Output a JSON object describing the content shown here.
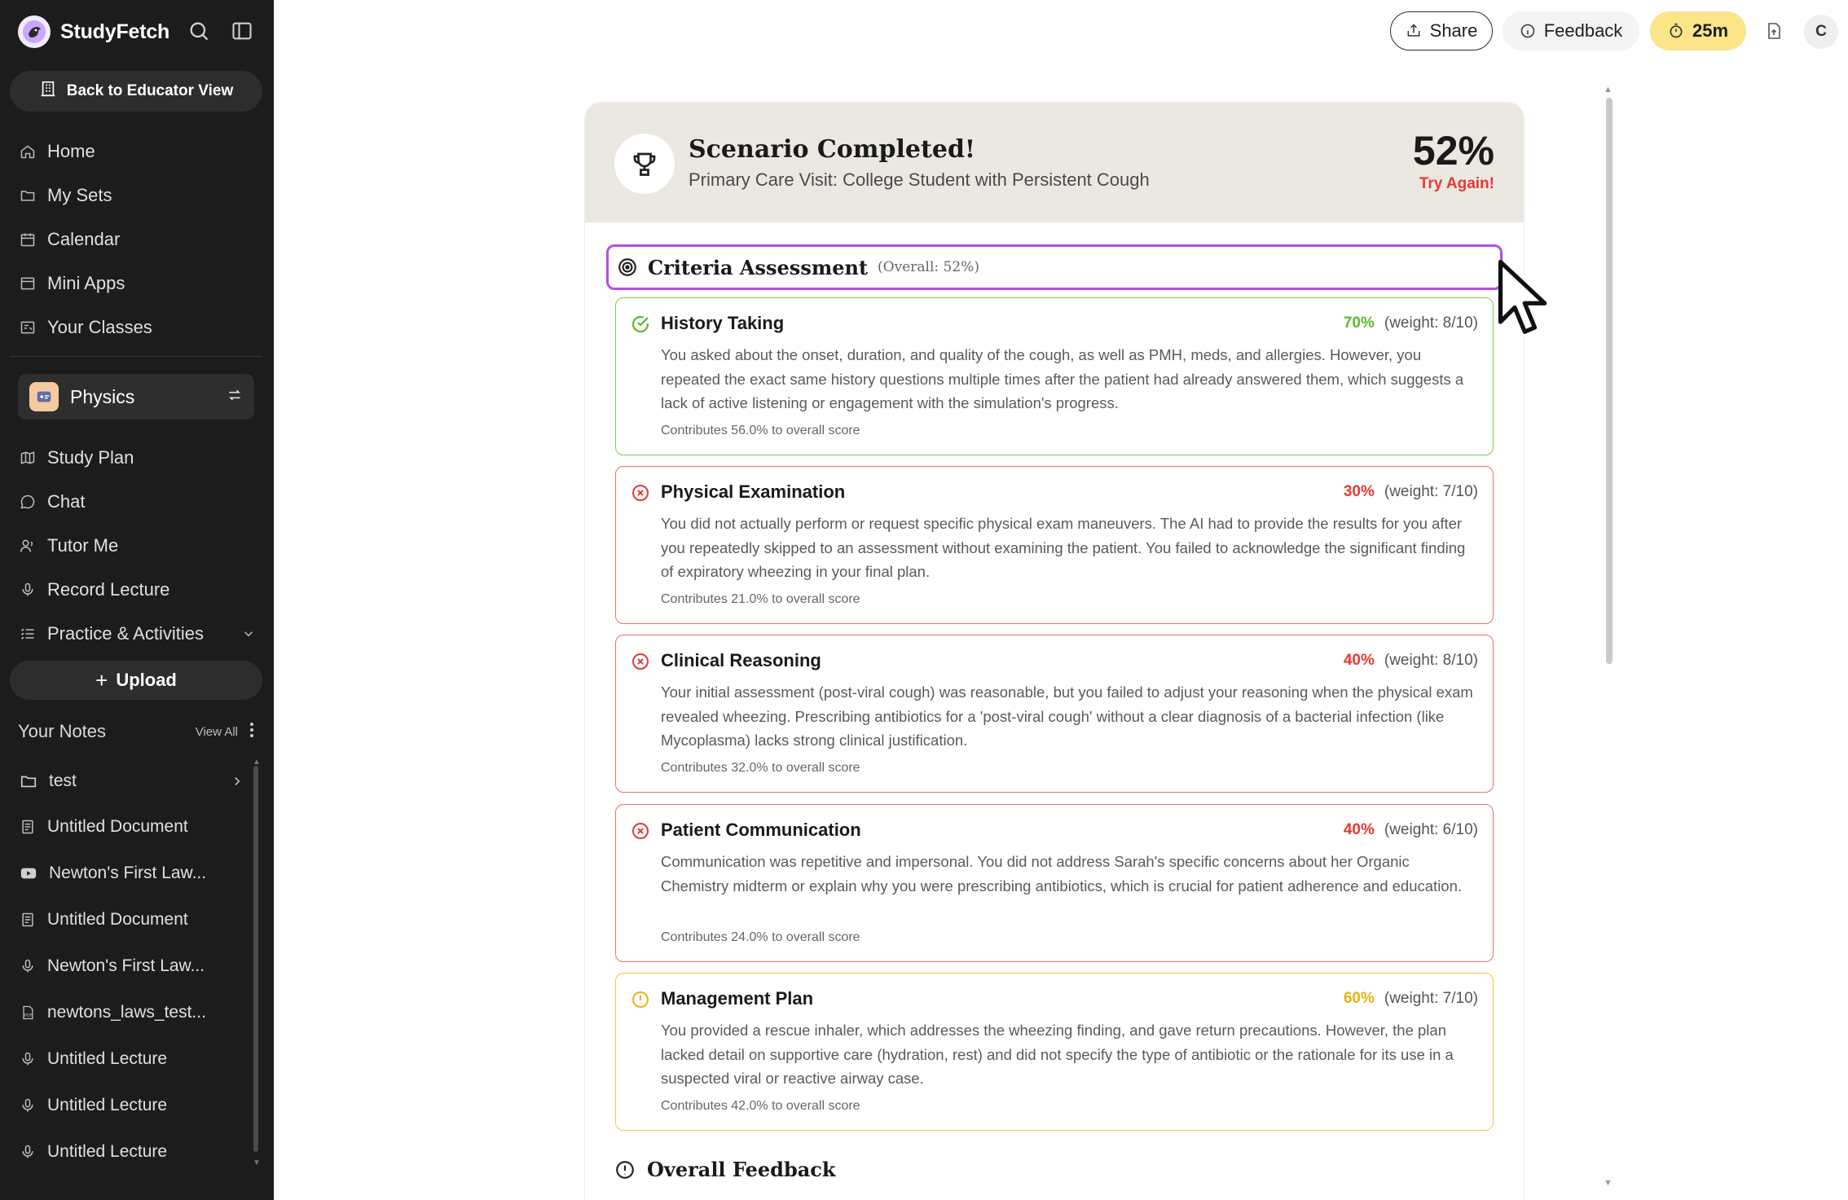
{
  "app": {
    "name": "StudyFetch"
  },
  "sidebar": {
    "educator_button": "Back to Educator View",
    "nav": [
      {
        "label": "Home",
        "icon": "home-icon"
      },
      {
        "label": "My Sets",
        "icon": "folder-icon"
      },
      {
        "label": "Calendar",
        "icon": "calendar-icon"
      },
      {
        "label": "Mini Apps",
        "icon": "app-window-icon"
      },
      {
        "label": "Your Classes",
        "icon": "classes-icon"
      }
    ],
    "class": {
      "name": "Physics"
    },
    "class_nav": [
      {
        "label": "Study Plan",
        "icon": "map-icon"
      },
      {
        "label": "Chat",
        "icon": "chat-icon"
      },
      {
        "label": "Tutor Me",
        "icon": "tutor-icon"
      },
      {
        "label": "Record Lecture",
        "icon": "microphone-icon"
      },
      {
        "label": "Practice & Activities",
        "icon": "list-icon"
      }
    ],
    "upload_label": "Upload",
    "notes": {
      "title": "Your Notes",
      "view_all": "View All",
      "items": [
        {
          "label": "test",
          "icon": "folder-icon"
        },
        {
          "label": "Untitled Document",
          "icon": "document-icon"
        },
        {
          "label": "Newton's First Law...",
          "icon": "youtube-icon"
        },
        {
          "label": "Untitled Document",
          "icon": "document-icon"
        },
        {
          "label": "Newton's First Law...",
          "icon": "microphone-icon"
        },
        {
          "label": "newtons_laws_test...",
          "icon": "pdf-icon"
        },
        {
          "label": "Untitled Lecture",
          "icon": "microphone-icon"
        },
        {
          "label": "Untitled Lecture",
          "icon": "microphone-icon"
        },
        {
          "label": "Untitled Lecture",
          "icon": "microphone-icon"
        }
      ]
    }
  },
  "topbar": {
    "share_label": "Share",
    "feedback_label": "Feedback",
    "timer_label": "25m",
    "avatar_initial": "C"
  },
  "scenario": {
    "title": "Scenario Completed!",
    "subtitle": "Primary Care Visit: College Student with Persistent Cough",
    "score": "52%",
    "status": "Try Again!"
  },
  "criteria": {
    "title": "Criteria Assessment",
    "overall": "(Overall: 52%)",
    "items": [
      {
        "name": "History Taking",
        "percent": "70%",
        "weight": "(weight: 8/10)",
        "status": "pass",
        "feedback": "You asked about the onset, duration, and quality of the cough, as well as PMH, meds, and allergies. However, you repeated the exact same history questions multiple times after the patient had already answered them, which suggests a lack of active listening or engagement with the simulation's progress.",
        "contribution": "Contributes 56.0% to overall score"
      },
      {
        "name": "Physical Examination",
        "percent": "30%",
        "weight": "(weight: 7/10)",
        "status": "fail",
        "feedback": "You did not actually perform or request specific physical exam maneuvers. The AI had to provide the results for you after you repeatedly skipped to an assessment without examining the patient. You failed to acknowledge the significant finding of expiratory wheezing in your final plan.",
        "contribution": "Contributes 21.0% to overall score"
      },
      {
        "name": "Clinical Reasoning",
        "percent": "40%",
        "weight": "(weight: 8/10)",
        "status": "fail",
        "feedback": "Your initial assessment (post-viral cough) was reasonable, but you failed to adjust your reasoning when the physical exam revealed wheezing. Prescribing antibiotics for a 'post-viral cough' without a clear diagnosis of a bacterial infection (like Mycoplasma) lacks strong clinical justification.",
        "contribution": "Contributes 32.0% to overall score"
      },
      {
        "name": "Patient Communication",
        "percent": "40%",
        "weight": "(weight: 6/10)",
        "status": "fail",
        "feedback": "Communication was repetitive and impersonal. You did not address Sarah's specific concerns about her Organic Chemistry midterm or explain why you were prescribing antibiotics, which is crucial for patient adherence and education.",
        "contribution": "Contributes 24.0% to overall score"
      },
      {
        "name": "Management Plan",
        "percent": "60%",
        "weight": "(weight: 7/10)",
        "status": "warning",
        "feedback": "You provided a rescue inhaler, which addresses the wheezing finding, and gave return precautions. However, the plan lacked detail on supportive care (hydration, rest) and did not specify the type of antibiotic or the rationale for its use in a suspected viral or reactive airway case.",
        "contribution": "Contributes 42.0% to overall score"
      }
    ]
  },
  "overall_feedback": {
    "title": "Overall Feedback"
  },
  "colors": {
    "sidebar_bg": "#1c1c1c",
    "accent_purple": "#b44fe0",
    "pass_green": "#5cb82a",
    "fail_red": "#e53935",
    "warn_amber": "#e8b411",
    "timer_yellow": "#fbe588",
    "header_beige": "#ebe8e2"
  }
}
